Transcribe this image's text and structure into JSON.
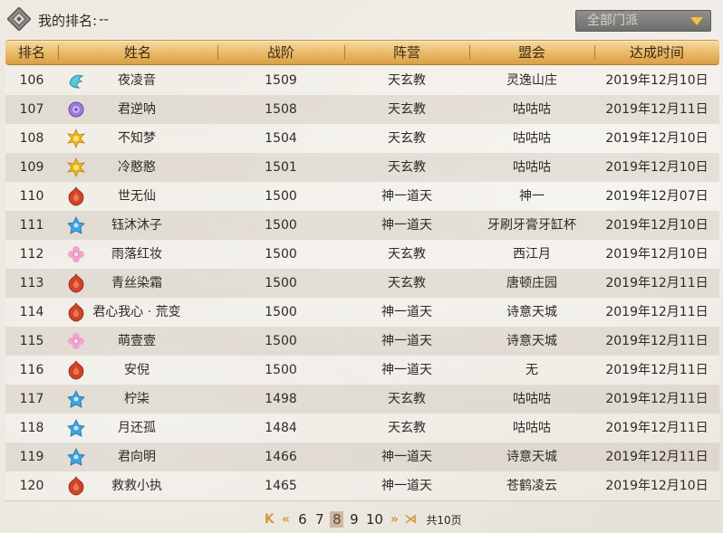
{
  "header": {
    "my_rank_label": "我的排名:",
    "my_rank_value": "--",
    "school_filter": "全部门派"
  },
  "columns": [
    "排名",
    "姓名",
    "战阶",
    "阵营",
    "盟会",
    "达成时间"
  ],
  "colors": {
    "header_gold": "#e9b865",
    "caret_gold": "#f2c23a",
    "pager_arrow": "#d49a3a"
  },
  "rows": [
    {
      "rank": "106",
      "sect_icon": "cyan-bird-icon",
      "name": "夜凌音",
      "tier": "1509",
      "camp": "天玄教",
      "guild": "灵逸山庄",
      "date": "2019年12月10日"
    },
    {
      "rank": "107",
      "sect_icon": "purple-lotus-icon",
      "name": "君逆呐",
      "tier": "1508",
      "camp": "天玄教",
      "guild": "咕咕咕",
      "date": "2019年12月11日"
    },
    {
      "rank": "108",
      "sect_icon": "gold-sun-icon",
      "name": "不知梦",
      "tier": "1504",
      "camp": "天玄教",
      "guild": "咕咕咕",
      "date": "2019年12月10日"
    },
    {
      "rank": "109",
      "sect_icon": "gold-sun-icon",
      "name": "冷憨憨",
      "tier": "1501",
      "camp": "天玄教",
      "guild": "咕咕咕",
      "date": "2019年12月10日"
    },
    {
      "rank": "110",
      "sect_icon": "red-flame-icon",
      "name": "世无仙",
      "tier": "1500",
      "camp": "神一道天",
      "guild": "神一",
      "date": "2019年12月07日"
    },
    {
      "rank": "111",
      "sect_icon": "blue-crest-icon",
      "name": "钰沐沐子",
      "tier": "1500",
      "camp": "神一道天",
      "guild": "牙刷牙膏牙缸杯",
      "date": "2019年12月10日"
    },
    {
      "rank": "112",
      "sect_icon": "pink-blossom-icon",
      "name": "雨落红妆",
      "tier": "1500",
      "camp": "天玄教",
      "guild": "西江月",
      "date": "2019年12月10日"
    },
    {
      "rank": "113",
      "sect_icon": "red-flame-icon",
      "name": "青丝染霜",
      "tier": "1500",
      "camp": "天玄教",
      "guild": "唐顿庄园",
      "date": "2019年12月11日"
    },
    {
      "rank": "114",
      "sect_icon": "red-flame-icon",
      "name": "君心我心 · 荒变",
      "tier": "1500",
      "camp": "神一道天",
      "guild": "诗意天城",
      "date": "2019年12月11日"
    },
    {
      "rank": "115",
      "sect_icon": "pink-blossom-icon",
      "name": "萌壹壹",
      "tier": "1500",
      "camp": "神一道天",
      "guild": "诗意天城",
      "date": "2019年12月11日"
    },
    {
      "rank": "116",
      "sect_icon": "red-flame-icon",
      "name": "安倪",
      "tier": "1500",
      "camp": "神一道天",
      "guild": "无",
      "date": "2019年12月11日"
    },
    {
      "rank": "117",
      "sect_icon": "blue-crest-icon",
      "name": "柠柒",
      "tier": "1498",
      "camp": "天玄教",
      "guild": "咕咕咕",
      "date": "2019年12月11日"
    },
    {
      "rank": "118",
      "sect_icon": "blue-crest-icon",
      "name": "月还孤",
      "tier": "1484",
      "camp": "天玄教",
      "guild": "咕咕咕",
      "date": "2019年12月11日"
    },
    {
      "rank": "119",
      "sect_icon": "blue-crest-icon",
      "name": "君向明",
      "tier": "1466",
      "camp": "神一道天",
      "guild": "诗意天城",
      "date": "2019年12月11日"
    },
    {
      "rank": "120",
      "sect_icon": "red-flame-icon",
      "name": "救救小执",
      "tier": "1465",
      "camp": "神一道天",
      "guild": "苍鹤凌云",
      "date": "2019年12月10日"
    }
  ],
  "pagination": {
    "pages": [
      "6",
      "7",
      "8",
      "9",
      "10"
    ],
    "current": "8",
    "total_label": "共10页"
  }
}
